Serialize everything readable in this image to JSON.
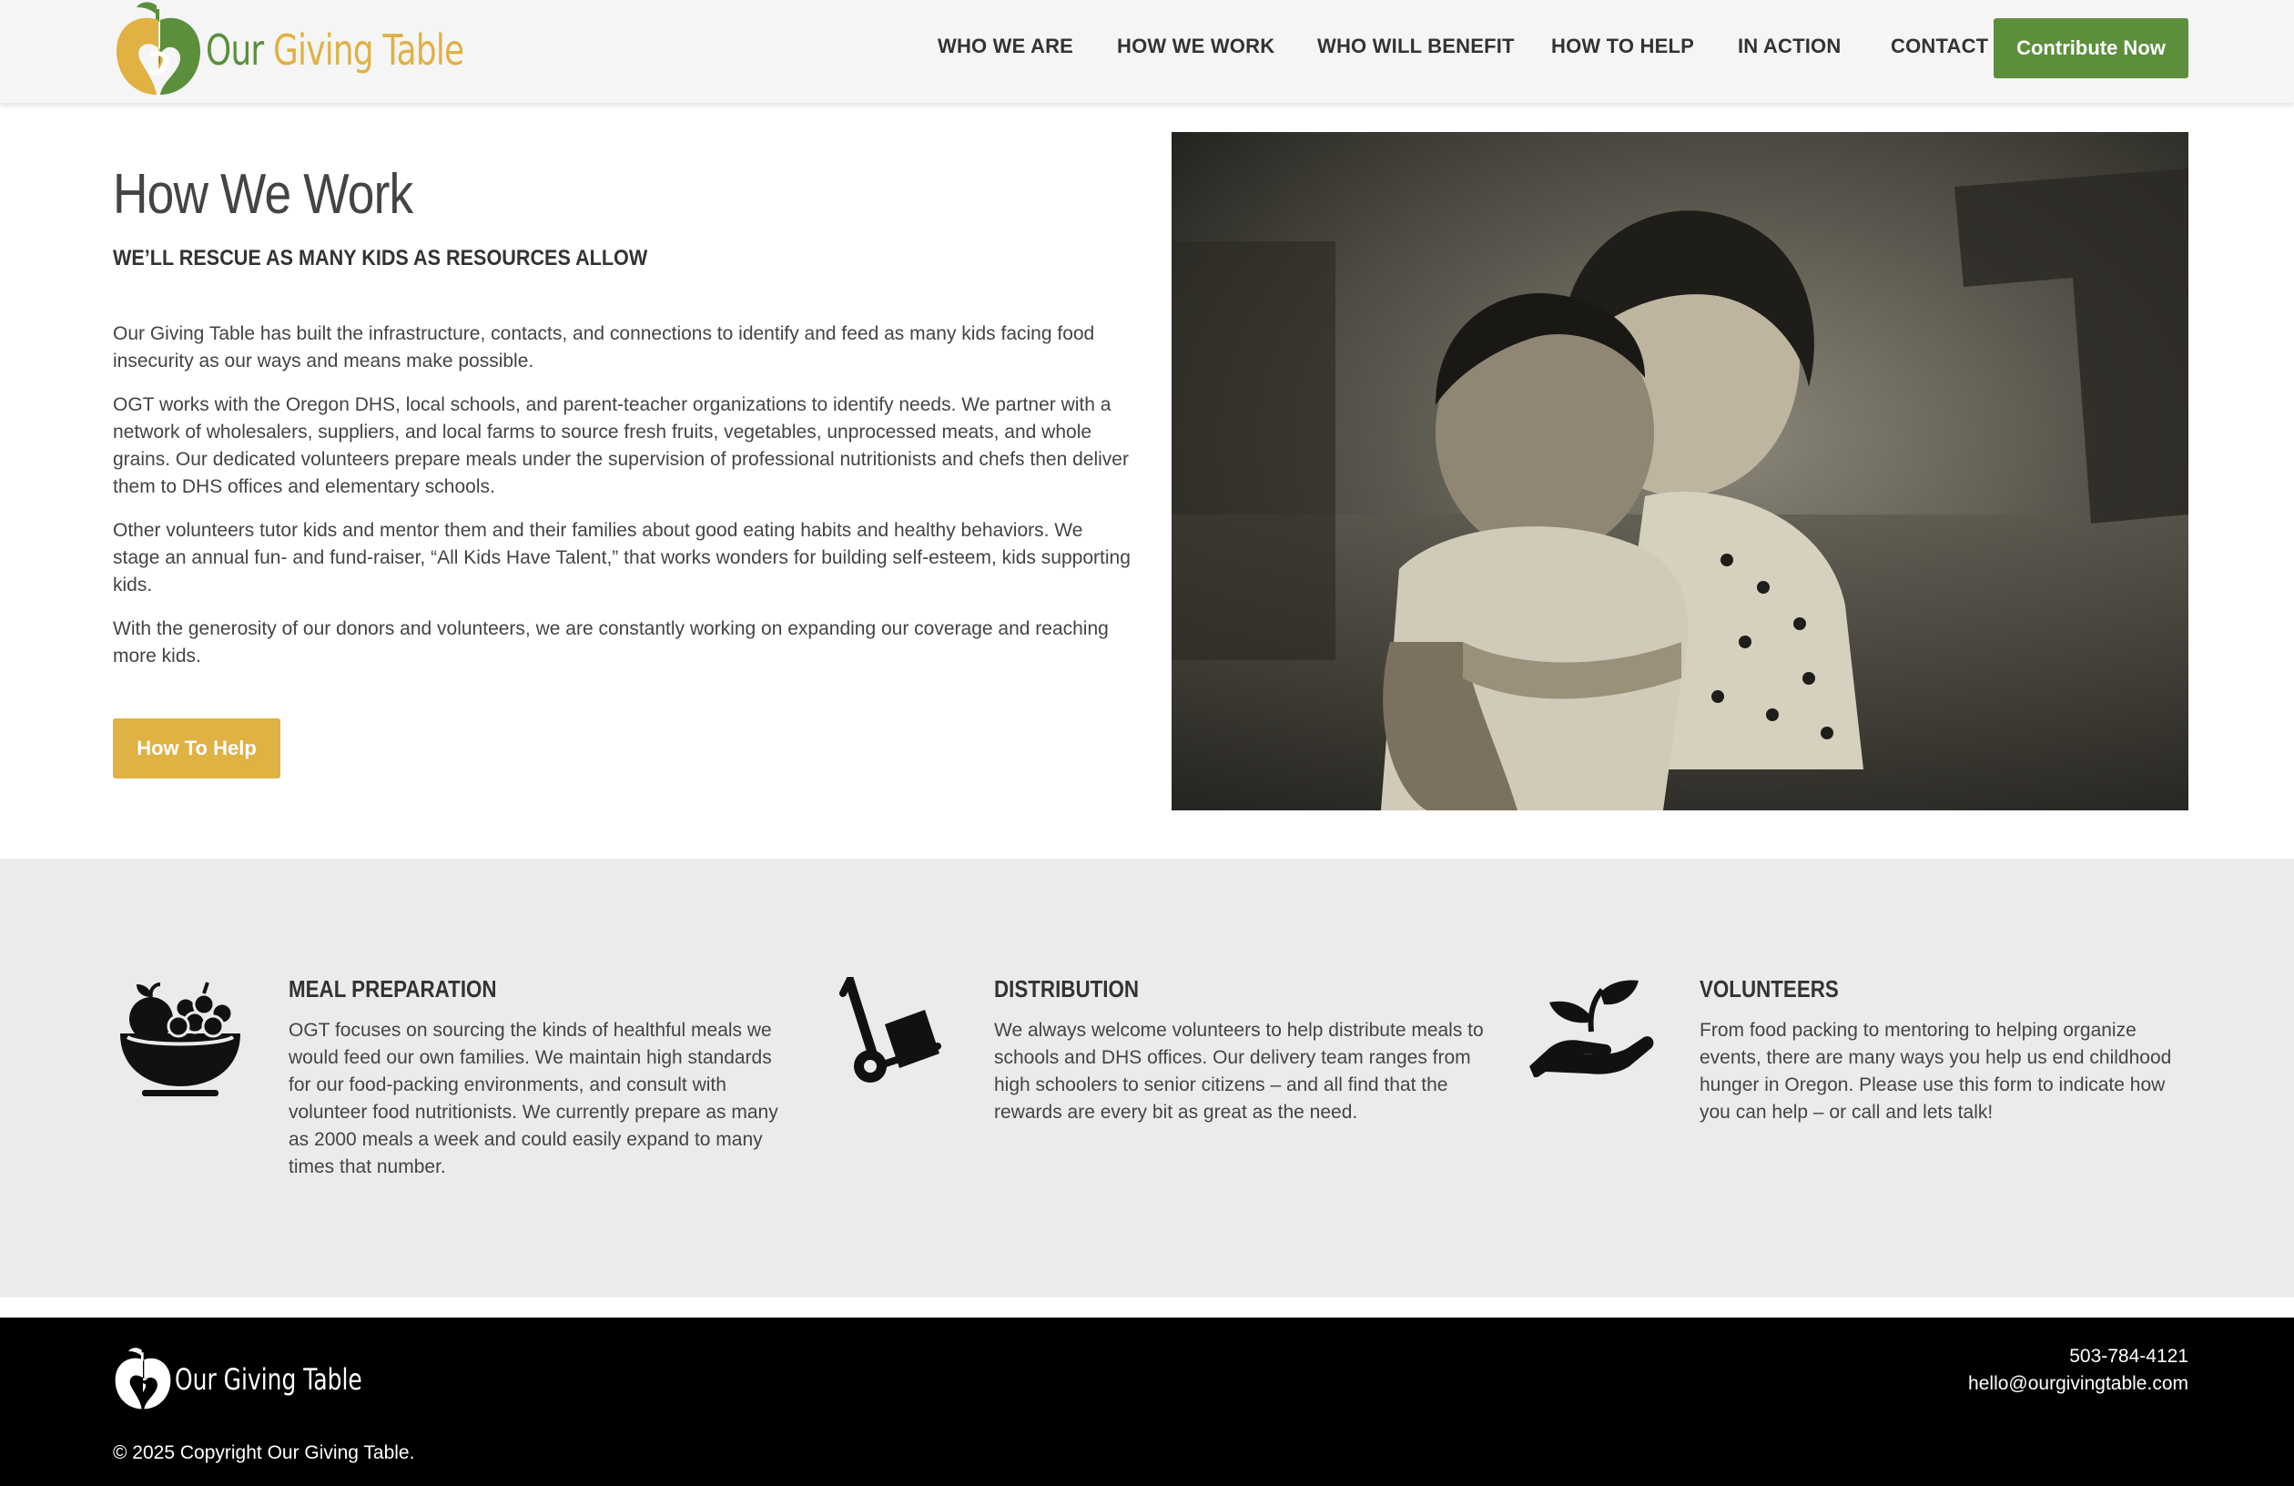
{
  "brand": {
    "name_word1": "Our",
    "name_word2": "Giving Table",
    "footer_name": "Our Giving Table",
    "colors": {
      "green": "#5c8f3c",
      "gold": "#e0b143",
      "dark_text": "#333333"
    }
  },
  "nav": {
    "items": [
      {
        "label": "WHO WE ARE"
      },
      {
        "label": "HOW WE WORK"
      },
      {
        "label": "WHO WILL BENEFIT"
      },
      {
        "label": "HOW TO HELP"
      },
      {
        "label": "IN ACTION"
      },
      {
        "label": "CONTACT"
      }
    ],
    "cta_label": "Contribute Now"
  },
  "hero": {
    "title": "How We Work",
    "subtitle": "WE’LL RESCUE AS MANY KIDS AS RESOURCES ALLOW",
    "paragraphs": [
      "Our Giving Table has built the infrastructure, contacts, and connections to identify and feed as many kids facing food insecurity as our ways and means make possible.",
      "OGT works with the Oregon DHS, local schools, and parent-teacher organizations to identify needs. We partner with a network of wholesalers, suppliers, and local farms to source fresh fruits, vegetables, unprocessed meats, and whole grains. Our dedicated volunteers prepare meals under the supervision of professional nutritionists and chefs then deliver them to DHS offices and elementary schools.",
      "Other volunteers tutor kids and mentor them and their families about good eating habits and healthy behaviors. We stage an annual fun- and fund-raiser, “All Kids Have Talent,” that works wonders for building self-esteem, kids supporting kids.",
      "With the generosity of our donors and volunteers, we are constantly working on expanding our coverage and reaching more kids."
    ],
    "button_label": "How To Help",
    "photo_icon": "two-children-photo"
  },
  "features": [
    {
      "icon": "fruit-bowl-icon",
      "title": "MEAL PREPARATION",
      "text": "OGT focuses on sourcing the kinds of healthful meals we would feed our own families. We maintain high standards for our food-packing environments, and consult with volunteer food nutritionists. We currently prepare as many as 2000 meals a week and could easily expand to many times that number."
    },
    {
      "icon": "hand-truck-icon",
      "title": "DISTRIBUTION",
      "text": "We always welcome volunteers to help distribute meals to schools and DHS offices. Our delivery team ranges from high schoolers to senior citizens – and all find that the rewards are every bit as great as the need."
    },
    {
      "icon": "hand-sprout-icon",
      "title": "VOLUNTEERS",
      "text": "From food packing to mentoring to helping organize events, there are many ways you help us end childhood hunger in Oregon. Please use this form to indicate how you can help – or call and lets talk!"
    }
  ],
  "footer": {
    "phone": "503-784-4121",
    "email": "hello@ourgivingtable.com",
    "copyright": "© 2025 Copyright Our Giving Table."
  }
}
